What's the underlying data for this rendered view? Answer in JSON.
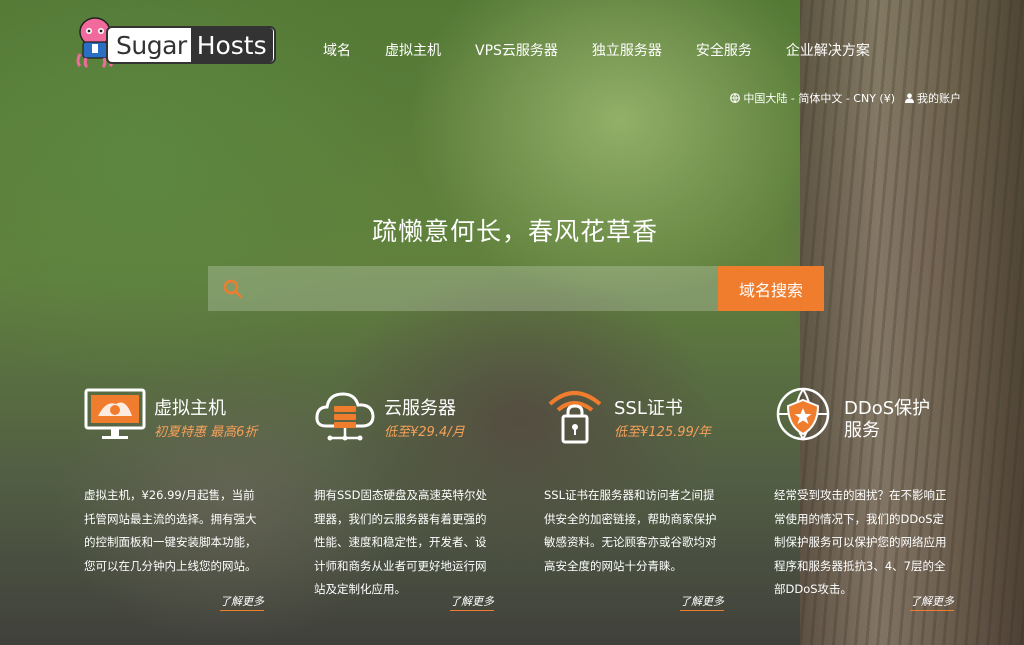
{
  "brand": {
    "sugar": "Sugar",
    "hosts": "Hosts"
  },
  "nav": [
    "域名",
    "虚拟主机",
    "VPS云服务器",
    "独立服务器",
    "安全服务",
    "企业解决方案"
  ],
  "topbar": {
    "region": "中国大陆 - 简体中文 - CNY (¥)",
    "account": "我的账户"
  },
  "hero": {
    "slogan": "疏懒意何长，春风花草香"
  },
  "search": {
    "placeholder": "",
    "button": "域名搜索"
  },
  "features": [
    {
      "title": "虚拟主机",
      "sub": "初夏特惠 最高6折",
      "desc": "虚拟主机，¥26.99/月起售，当前托管网站最主流的选择。拥有强大的控制面板和一键安装脚本功能，您可以在几分钟内上线您的网站。",
      "more": "了解更多",
      "icon": "monitor-icon"
    },
    {
      "title": "云服务器",
      "sub": "低至¥29.4/月",
      "desc": "拥有SSD固态硬盘及高速英特尔处理器，我们的云服务器有着更强的性能、速度和稳定性，开发者、设计师和商务从业者可更好地运行网站及定制化应用。",
      "more": "了解更多",
      "icon": "cloud-server-icon"
    },
    {
      "title": "SSL证书",
      "sub": "低至¥125.99/年",
      "desc": "SSL证书在服务器和访问者之间提供安全的加密链接，帮助商家保护敏感资料。无论顾客亦或谷歌均对高安全度的网站十分青睐。",
      "more": "了解更多",
      "icon": "ssl-lock-icon"
    },
    {
      "title": "DDoS保护服务",
      "sub": "",
      "desc": "经常受到攻击的困扰？在不影响正常使用的情况下，我们的DDoS定制保护服务可以保护您的网络应用程序和服务器抵抗3、4、7层的全部DDoS攻击。",
      "more": "了解更多",
      "icon": "shield-globe-icon"
    }
  ],
  "colors": {
    "accent": "#f07c2e",
    "accent_text": "#f5a15a"
  }
}
